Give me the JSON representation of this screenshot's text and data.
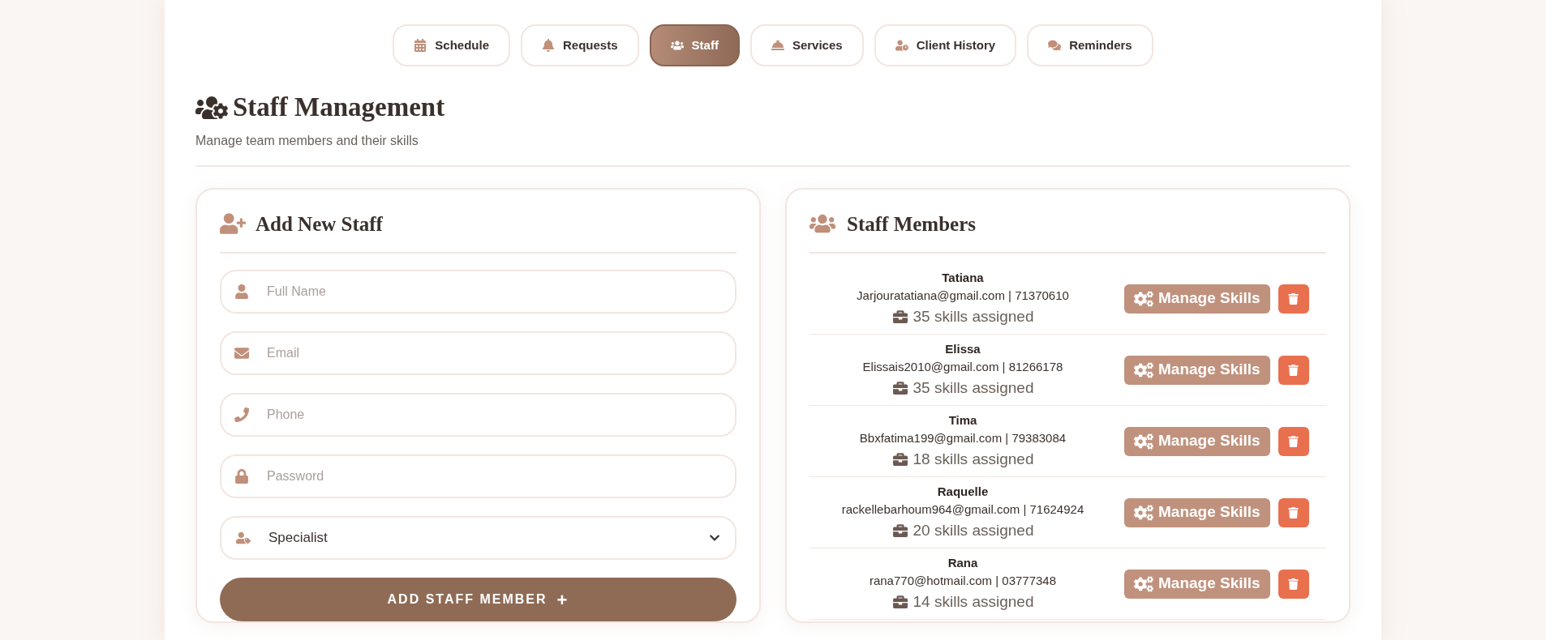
{
  "tabs": [
    {
      "label": "Schedule",
      "selected": false
    },
    {
      "label": "Requests",
      "selected": false
    },
    {
      "label": "Staff",
      "selected": true
    },
    {
      "label": "Services",
      "selected": false
    },
    {
      "label": "Client History",
      "selected": false
    },
    {
      "label": "Reminders",
      "selected": false
    }
  ],
  "header": {
    "title": "Staff Management",
    "subtitle": "Manage team members and their skills"
  },
  "add_form": {
    "title": "Add New Staff",
    "fields": [
      {
        "kind": "text",
        "placeholder": "Full Name"
      },
      {
        "kind": "text",
        "placeholder": "Email"
      },
      {
        "kind": "text",
        "placeholder": "Phone"
      },
      {
        "kind": "text",
        "placeholder": "Password"
      },
      {
        "kind": "select",
        "value": "Specialist"
      }
    ],
    "submit": "ADD STAFF MEMBER",
    "submit_symbol": "+"
  },
  "staff_list": {
    "title": "Staff Members",
    "members": [
      {
        "name": "Tatiana",
        "contact": "Jarjouratatiana@gmail.com | 71370610",
        "skills": "35 skills assigned",
        "manage_label": "Manage Skills"
      },
      {
        "name": "Elissa",
        "contact": "Elissais2010@gmail.com | 81266178",
        "skills": "35 skills assigned",
        "manage_label": "Manage Skills"
      },
      {
        "name": "Tima",
        "contact": "Bbxfatima199@gmail.com | 79383084",
        "skills": "18 skills assigned",
        "manage_label": "Manage Skills"
      },
      {
        "name": "Raquelle",
        "contact": "rackellebarhoum964@gmail.com | 71624924",
        "skills": "20 skills assigned",
        "manage_label": "Manage Skills"
      },
      {
        "name": "Rana",
        "contact": "rana770@hotmail.com | 03777348",
        "skills": "14 skills assigned",
        "manage_label": "Manage Skills"
      }
    ]
  }
}
